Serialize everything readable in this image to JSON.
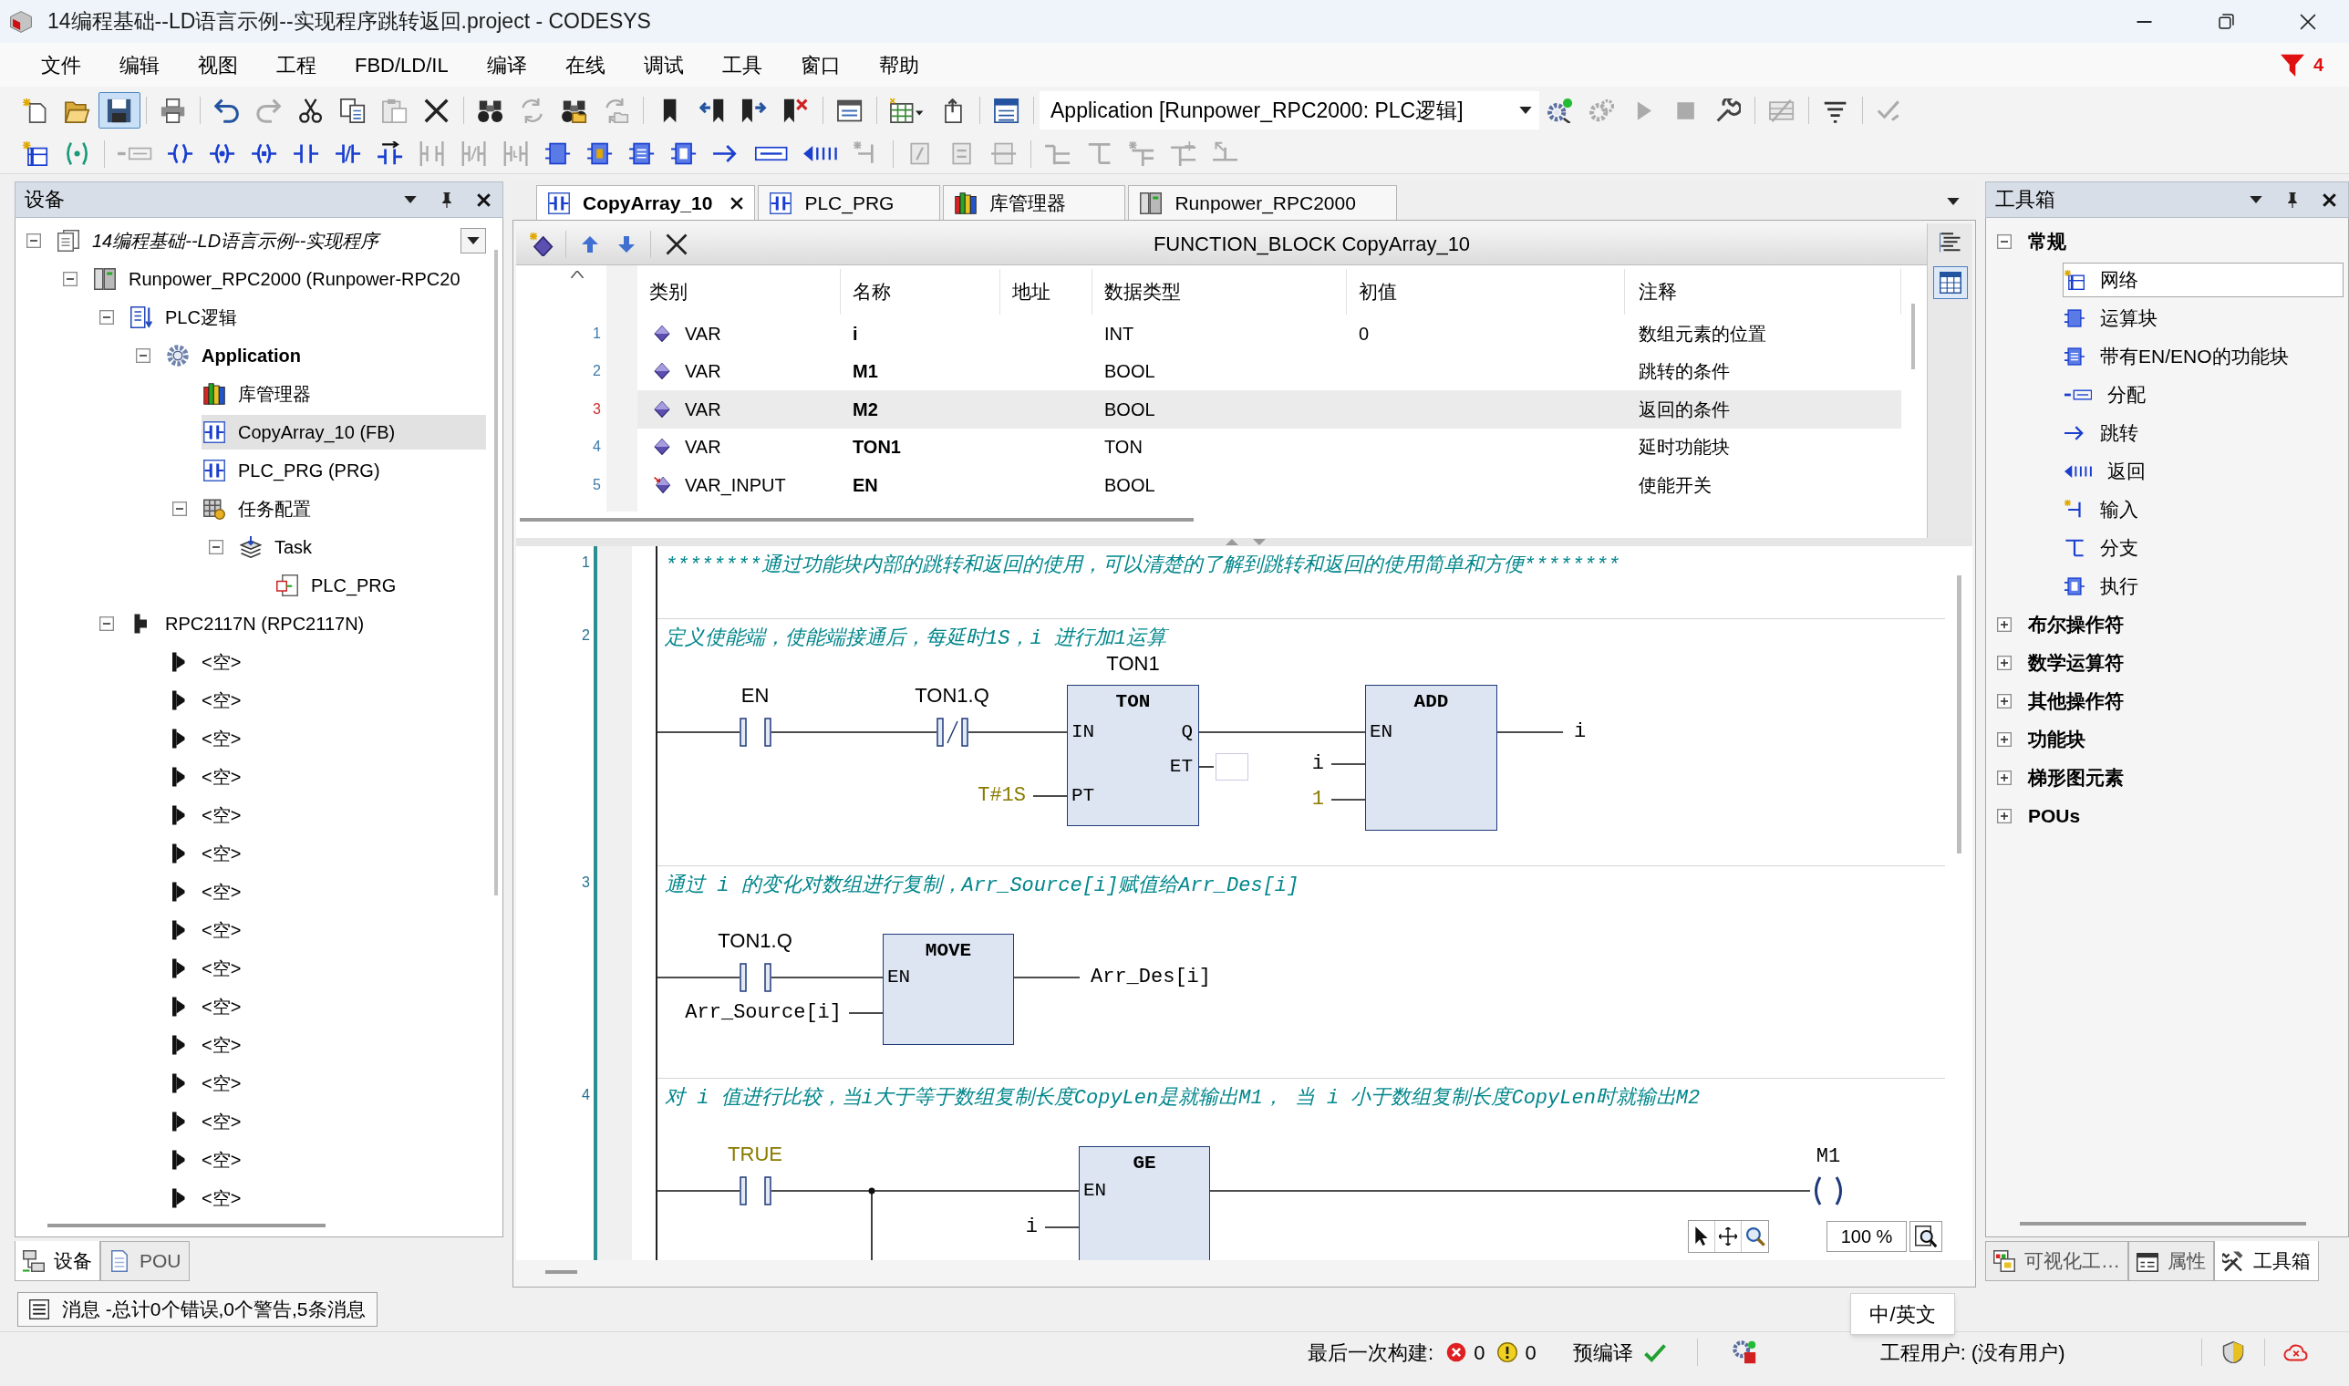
{
  "window": {
    "title": "14编程基础--LD语言示例--实现程序跳转返回.project - CODESYS"
  },
  "menu": [
    "文件",
    "编辑",
    "视图",
    "工程",
    "FBD/LD/IL",
    "编译",
    "在线",
    "调试",
    "工具",
    "窗口",
    "帮助"
  ],
  "notification": {
    "count": "4"
  },
  "toolbar_main": {
    "groups": [
      [
        {
          "kind": "new",
          "disabled": false
        },
        {
          "kind": "open",
          "disabled": false
        },
        {
          "kind": "save",
          "disabled": false,
          "highlighted": true
        }
      ],
      [
        {
          "kind": "print",
          "disabled": false
        }
      ],
      [
        {
          "kind": "undo",
          "disabled": false
        },
        {
          "kind": "redo",
          "disabled": true
        },
        {
          "kind": "cut",
          "disabled": false
        },
        {
          "kind": "copy",
          "disabled": false
        },
        {
          "kind": "paste",
          "disabled": true
        },
        {
          "kind": "delete",
          "disabled": false
        }
      ],
      [
        {
          "kind": "find",
          "disabled": false
        },
        {
          "kind": "replace",
          "disabled": true
        },
        {
          "kind": "find_project",
          "disabled": false
        },
        {
          "kind": "replace_project",
          "disabled": true
        }
      ],
      [
        {
          "kind": "bookmark",
          "disabled": false
        },
        {
          "kind": "bookmark_prev",
          "disabled": false
        },
        {
          "kind": "bookmark_next",
          "disabled": false
        },
        {
          "kind": "bookmark_clear",
          "disabled": false
        }
      ],
      [
        {
          "kind": "messages",
          "disabled": false
        }
      ],
      [
        {
          "kind": "grid_menu",
          "disabled": false
        },
        {
          "kind": "export",
          "disabled": false
        }
      ],
      [
        {
          "kind": "watch",
          "disabled": false
        }
      ]
    ],
    "application": "Application [Runpower_RPC2000: PLC逻辑]",
    "groups_after": [
      [
        {
          "kind": "login",
          "disabled": false
        },
        {
          "kind": "logout",
          "disabled": true
        },
        {
          "kind": "run",
          "disabled": true
        },
        {
          "kind": "stop",
          "disabled": true
        },
        {
          "kind": "reset",
          "disabled": false
        }
      ],
      [
        {
          "kind": "force",
          "disabled": true
        }
      ],
      [
        {
          "kind": "filter",
          "disabled": false
        }
      ],
      [
        {
          "kind": "sync",
          "disabled": true
        }
      ]
    ]
  },
  "toolbar_ld": {
    "groups": [
      [
        {
          "kind": "network",
          "disabled": false
        },
        {
          "kind": "comment",
          "disabled": false
        }
      ],
      [
        {
          "kind": "assign",
          "disabled": true
        },
        {
          "kind": "coil",
          "disabled": false
        },
        {
          "kind": "set_coil",
          "disabled": false
        },
        {
          "kind": "reset_coil",
          "disabled": false
        },
        {
          "kind": "contact",
          "disabled": false
        },
        {
          "kind": "negated_contact",
          "disabled": false
        },
        {
          "kind": "contact_arrow",
          "disabled": false
        },
        {
          "kind": "parallel_contact",
          "disabled": true
        },
        {
          "kind": "parallel_negated",
          "disabled": true
        },
        {
          "kind": "parallel_edge",
          "disabled": true
        },
        {
          "kind": "box",
          "disabled": false
        },
        {
          "kind": "box_query",
          "disabled": false
        },
        {
          "kind": "box_en",
          "disabled": false
        },
        {
          "kind": "box_exec",
          "disabled": false
        },
        {
          "kind": "jump",
          "disabled": false
        },
        {
          "kind": "label",
          "disabled": false
        },
        {
          "kind": "return",
          "disabled": false
        },
        {
          "kind": "input",
          "disabled": true
        }
      ],
      [
        {
          "kind": "negate",
          "disabled": true
        },
        {
          "kind": "edge",
          "disabled": true
        },
        {
          "kind": "set_reset",
          "disabled": true
        }
      ],
      [
        {
          "kind": "branch_open",
          "disabled": true
        },
        {
          "kind": "branch_close",
          "disabled": true
        },
        {
          "kind": "branch_insert",
          "disabled": true
        },
        {
          "kind": "branch_below",
          "disabled": true
        },
        {
          "kind": "branch_remove",
          "disabled": true
        }
      ]
    ]
  },
  "devices": {
    "title": "设备",
    "tree": [
      {
        "label": "14编程基础--LD语言示例--实现程序",
        "kind": "project",
        "selected": false,
        "expanded": true,
        "children": [
          {
            "label": "Runpower_RPC2000 (Runpower-RPC20",
            "kind": "device",
            "selected": false,
            "expanded": true,
            "children": [
              {
                "label": "PLC逻辑",
                "kind": "plc_logic",
                "selected": false,
                "expanded": true,
                "children": [
                  {
                    "label": "Application",
                    "kind": "application",
                    "selected": false,
                    "expanded": true,
                    "children": [
                      {
                        "label": "库管理器",
                        "kind": "library",
                        "selected": false
                      },
                      {
                        "label": "CopyArray_10 (FB)",
                        "kind": "pou_fb",
                        "selected": true
                      },
                      {
                        "label": "PLC_PRG (PRG)",
                        "kind": "pou_prg",
                        "selected": false
                      },
                      {
                        "label": "任务配置",
                        "kind": "task_config",
                        "selected": false,
                        "expanded": true,
                        "children": [
                          {
                            "label": "Task",
                            "kind": "task",
                            "selected": false,
                            "expanded": true,
                            "children": [
                              {
                                "label": "PLC_PRG",
                                "kind": "program_call",
                                "selected": false
                              }
                            ]
                          }
                        ]
                      }
                    ]
                  }
                ]
              },
              {
                "label": "RPC2117N (RPC2117N)",
                "kind": "module",
                "selected": false,
                "expanded": true,
                "children": [
                  {
                    "label": "<空>",
                    "kind": "slot",
                    "selected": false
                  },
                  {
                    "label": "<空>",
                    "kind": "slot",
                    "selected": false
                  },
                  {
                    "label": "<空>",
                    "kind": "slot",
                    "selected": false
                  },
                  {
                    "label": "<空>",
                    "kind": "slot",
                    "selected": false
                  },
                  {
                    "label": "<空>",
                    "kind": "slot",
                    "selected": false
                  },
                  {
                    "label": "<空>",
                    "kind": "slot",
                    "selected": false
                  },
                  {
                    "label": "<空>",
                    "kind": "slot",
                    "selected": false
                  },
                  {
                    "label": "<空>",
                    "kind": "slot",
                    "selected": false
                  },
                  {
                    "label": "<空>",
                    "kind": "slot",
                    "selected": false
                  },
                  {
                    "label": "<空>",
                    "kind": "slot",
                    "selected": false
                  },
                  {
                    "label": "<空>",
                    "kind": "slot",
                    "selected": false
                  },
                  {
                    "label": "<空>",
                    "kind": "slot",
                    "selected": false
                  },
                  {
                    "label": "<空>",
                    "kind": "slot",
                    "selected": false
                  },
                  {
                    "label": "<空>",
                    "kind": "slot",
                    "selected": false
                  },
                  {
                    "label": "<空>",
                    "kind": "slot",
                    "selected": false
                  }
                ]
              }
            ]
          }
        ]
      }
    ],
    "tabs": [
      {
        "label": "设备",
        "kind": "devices",
        "selected": true
      },
      {
        "label": "POU",
        "kind": "pou",
        "selected": false
      }
    ]
  },
  "editor": {
    "tabs": [
      {
        "label": "CopyArray_10",
        "kind": "pou_fb",
        "selected": true
      },
      {
        "label": "PLC_PRG",
        "kind": "pou_prg",
        "selected": false
      },
      {
        "label": "库管理器",
        "kind": "library",
        "selected": false
      },
      {
        "label": "Runpower_RPC2000",
        "kind": "device",
        "selected": false
      }
    ],
    "header": "FUNCTION_BLOCK CopyArray_10",
    "view_modes": [
      {
        "kind": "text",
        "selected": false
      },
      {
        "kind": "table",
        "selected": true
      }
    ],
    "declarations": {
      "columns": [
        "类别",
        "名称",
        "地址",
        "数据类型",
        "初值",
        "注释"
      ],
      "rows": [
        {
          "line": "1",
          "kind": "var",
          "scope": "VAR",
          "name": "i",
          "type": "INT",
          "initial": "0",
          "comment": "数组元素的位置",
          "selected": false
        },
        {
          "line": "2",
          "kind": "var",
          "scope": "VAR",
          "name": "M1",
          "type": "BOOL",
          "comment": "跳转的条件",
          "selected": false
        },
        {
          "line": "3",
          "kind": "var",
          "scope": "VAR",
          "name": "M2",
          "type": "BOOL",
          "comment": "返回的条件",
          "selected": true
        },
        {
          "line": "4",
          "kind": "var",
          "scope": "VAR",
          "name": "TON1",
          "type": "TON",
          "comment": "延时功能块",
          "selected": false
        },
        {
          "line": "5",
          "kind": "var_input",
          "scope": "VAR_INPUT",
          "name": "EN",
          "type": "BOOL",
          "comment": "使能开关",
          "selected": false
        }
      ]
    },
    "networks": [
      {
        "number": "1",
        "comment": "********通过功能块内部的跳转和返回的使用，可以清楚的了解到跳转和返回的使用简单和方便********"
      },
      {
        "number": "2",
        "comment": "定义使能端，使能端接通后，每延时1S，i 进行加1运算",
        "contacts": [
          {
            "variable": "EN",
            "negated": false,
            "literal": false
          },
          {
            "variable": "TON1.Q",
            "negated": true,
            "literal": false
          }
        ],
        "blocks": [
          {
            "type": "TON",
            "instance": "TON1",
            "inputs": [
              {
                "pin": "IN"
              },
              {
                "pin": "PT",
                "value": "T#1S",
                "literal": true
              }
            ],
            "outputs": [
              {
                "pin": "Q"
              },
              {
                "pin": "ET"
              }
            ]
          },
          {
            "type": "ADD",
            "inputs": [
              {
                "pin": "EN"
              },
              {
                "value": "i",
                "literal": false
              },
              {
                "value": "1",
                "literal": true
              }
            ],
            "outputs": [
              {
                "value": "i"
              }
            ]
          }
        ]
      },
      {
        "number": "3",
        "comment": "通过 i 的变化对数组进行复制，Arr_Source[i]赋值给Arr_Des[i]",
        "contacts": [
          {
            "variable": "TON1.Q",
            "negated": false,
            "literal": false
          }
        ],
        "blocks": [
          {
            "type": "MOVE",
            "inputs": [
              {
                "pin": "EN"
              },
              {
                "value": "Arr_Source[i]",
                "literal": false
              }
            ],
            "outputs": [
              {
                "value": "Arr_Des[i]"
              }
            ]
          }
        ]
      },
      {
        "number": "4",
        "comment": "对 i 值进行比较，当i大于等于数组复制长度CopyLen是就输出M1， 当 i 小于数组复制长度CopyLen时就输出M2",
        "contacts": [
          {
            "variable": "TRUE",
            "negated": false,
            "literal": true
          }
        ],
        "parallel_branch": true,
        "blocks": [
          {
            "type": "GE",
            "inputs": [
              {
                "pin": "EN"
              },
              {
                "value": "i",
                "literal": false
              }
            ]
          }
        ],
        "coils": [
          {
            "variable": "M1"
          }
        ]
      }
    ],
    "zoom": "100 %"
  },
  "toolbox": {
    "title": "工具箱",
    "categories": [
      {
        "label": "常规",
        "expanded": true,
        "items": [
          {
            "label": "网络",
            "kind": "network",
            "selected": true
          },
          {
            "label": "运算块",
            "kind": "box",
            "selected": false
          },
          {
            "label": "带有EN/ENO的功能块",
            "kind": "box_en",
            "selected": false
          },
          {
            "label": "分配",
            "kind": "assign",
            "selected": false
          },
          {
            "label": "跳转",
            "kind": "jump",
            "selected": false
          },
          {
            "label": "返回",
            "kind": "return",
            "selected": false
          },
          {
            "label": "输入",
            "kind": "input",
            "selected": false
          },
          {
            "label": "分支",
            "kind": "branch_close",
            "selected": false
          },
          {
            "label": "执行",
            "kind": "box_exec",
            "selected": false
          }
        ]
      },
      {
        "label": "布尔操作符",
        "expanded": false
      },
      {
        "label": "数学运算符",
        "expanded": false
      },
      {
        "label": "其他操作符",
        "expanded": false
      },
      {
        "label": "功能块",
        "expanded": false
      },
      {
        "label": "梯形图元素",
        "expanded": false
      },
      {
        "label": "POUs",
        "expanded": false
      }
    ],
    "tabs": [
      {
        "label": "可视化工…",
        "kind": "visualization",
        "selected": false
      },
      {
        "label": "属性",
        "kind": "properties",
        "selected": false
      },
      {
        "label": "工具箱",
        "kind": "toolbox",
        "selected": true
      }
    ]
  },
  "messages": {
    "label": "消息 -总计0个错误,0个警告,5条消息"
  },
  "status_bar": {
    "last_build": "最后一次构建:",
    "errors": "0",
    "warnings": "0",
    "precompile": "预编译",
    "precompile_ok": true,
    "user": "工程用户: (没有用户)"
  },
  "ime_tooltip": "中/英文"
}
